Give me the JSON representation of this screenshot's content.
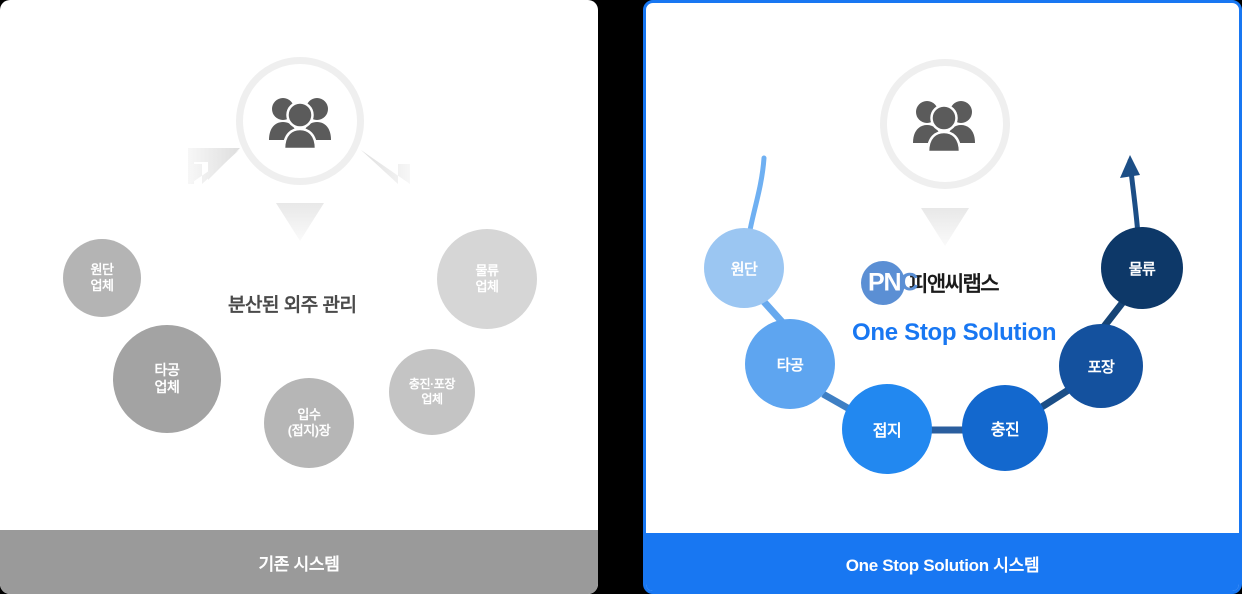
{
  "left_panel": {
    "title": "기존 시스템",
    "center_label": "분산된 외주 관리",
    "icon": "people-group-icon",
    "bubbles": [
      {
        "label": "원단\n업체",
        "name": "bubble-wondan"
      },
      {
        "label": "타공\n업체",
        "name": "bubble-tagong"
      },
      {
        "label": "입수\n(접지)장",
        "name": "bubble-ipsu"
      },
      {
        "label": "충진·포장\n업체",
        "name": "bubble-chungjin"
      },
      {
        "label": "물류\n업체",
        "name": "bubble-mullyu"
      }
    ],
    "colors": {
      "footer": "#9a9a9a",
      "ring": "#efefef",
      "icon": "#5b5b5b",
      "text": "#4a4a4a"
    }
  },
  "right_panel": {
    "title": "One Stop Solution 시스템",
    "brand": {
      "logo_text": "PNC",
      "logo_text_p": "P",
      "logo_text_n": "N",
      "logo_text_c": "C",
      "korean_name": "피앤씨랩스"
    },
    "tagline": "One Stop Solution",
    "icon": "people-group-icon",
    "nodes": [
      {
        "label": "원단",
        "name": "node-wondan",
        "color": "#9BC6F2"
      },
      {
        "label": "타공",
        "name": "node-tagong",
        "color": "#5EA5F0"
      },
      {
        "label": "접지",
        "name": "node-jeopji",
        "color": "#2288F0"
      },
      {
        "label": "충진",
        "name": "node-chungjin",
        "color": "#1368CE"
      },
      {
        "label": "포장",
        "name": "node-pojang",
        "color": "#14519E"
      },
      {
        "label": "물류",
        "name": "node-mullyu",
        "color": "#0D3868"
      }
    ],
    "colors": {
      "border": "#1877F2",
      "footer": "#1877F2",
      "tagline": "#1877F2",
      "brand_blue": "#5b8fd4"
    }
  }
}
